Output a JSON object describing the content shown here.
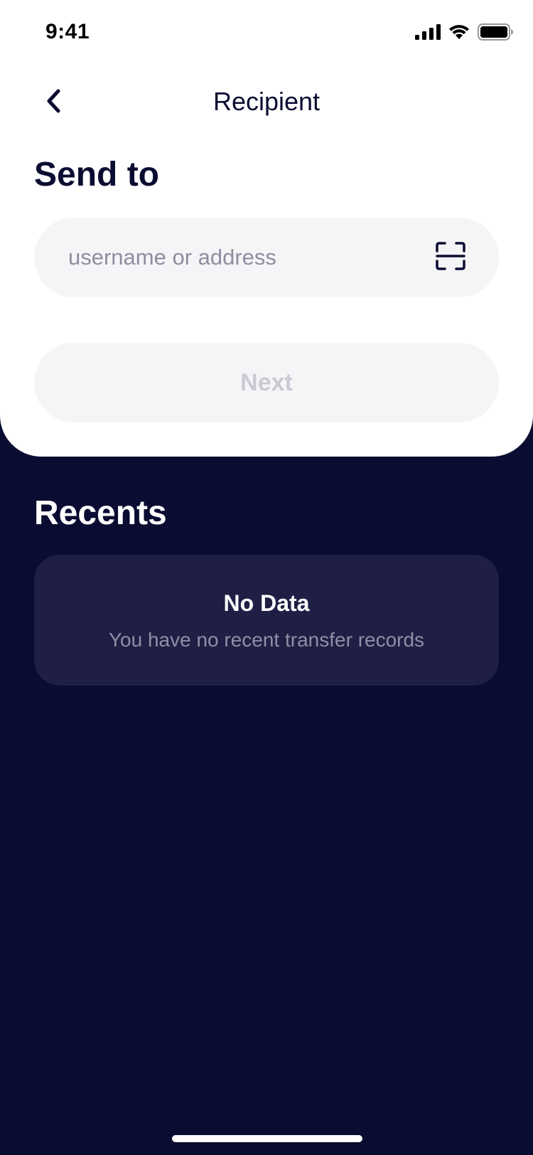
{
  "status_bar": {
    "time": "9:41",
    "icons": [
      "cellular-signal-icon",
      "wifi-icon",
      "battery-icon"
    ]
  },
  "nav": {
    "title": "Recipient",
    "back_icon": "chevron-left-icon"
  },
  "send_section": {
    "heading": "Send to",
    "input": {
      "value": "",
      "placeholder": "username or address"
    },
    "scan_icon": "qr-scan-icon",
    "next_label": "Next",
    "next_enabled": false
  },
  "recents": {
    "heading": "Recents",
    "empty_title": "No Data",
    "empty_message": "You have no recent transfer records"
  },
  "colors": {
    "background_dark": "#0A0C31",
    "sheet_background": "#FFFFFF",
    "field_background": "#F5F5F8",
    "card_background": "#1F1F45",
    "text_dark": "#0A0C31",
    "placeholder": "#8D8E9F",
    "disabled_text": "#C9CAD3",
    "muted_text": "#8E8FA6"
  }
}
